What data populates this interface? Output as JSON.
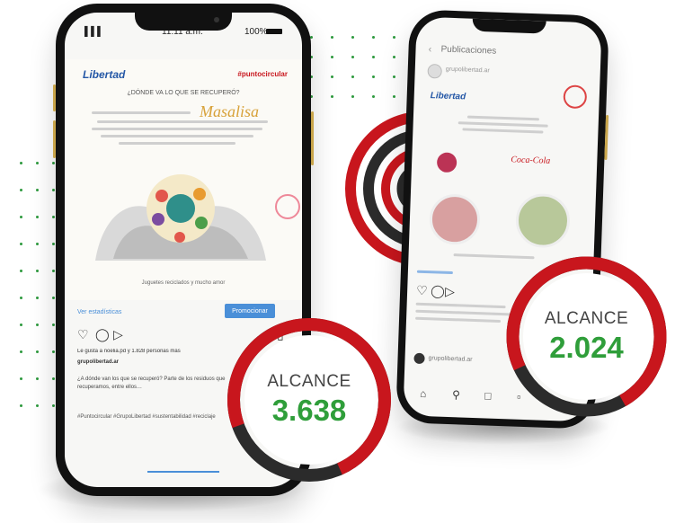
{
  "phone_left": {
    "status": {
      "time": "11:11 a.m.",
      "battery": "100%"
    },
    "brand_logo": "Libertad",
    "hashtag": "#puntocircular",
    "headline": "¿DÓNDE VA LO QUE SE RECUPERÓ?",
    "partner_logo": "Masalisa",
    "caption": "Juguetes reciclados y mucho amor",
    "link_left": "Ver estadísticas",
    "link_right": "Promocionar",
    "likes": "Le gusta a noelia.pd y 1.828 personas más",
    "account": "grupolibertad.ar",
    "body": "¿A dónde van los que se recuperó? Parte de los residuos que recuperamos, entre ellos…",
    "hashtags": "#Puntocircular #GrupoLibertad #sustentabilidad #reciclaje"
  },
  "phone_right": {
    "header": "Publicaciones",
    "account": "grupolibertad.ar",
    "brand_logo": "Libertad",
    "partner_logo": "Coca-Cola",
    "footer_account": "grupolibertad.ar"
  },
  "badges": {
    "left": {
      "label": "ALCANCE",
      "value": "3.638"
    },
    "right": {
      "label": "ALCANCE",
      "value": "2.024"
    }
  },
  "colors": {
    "red": "#c8161d",
    "green": "#2f9e3a",
    "dark": "#2b2b2b"
  }
}
